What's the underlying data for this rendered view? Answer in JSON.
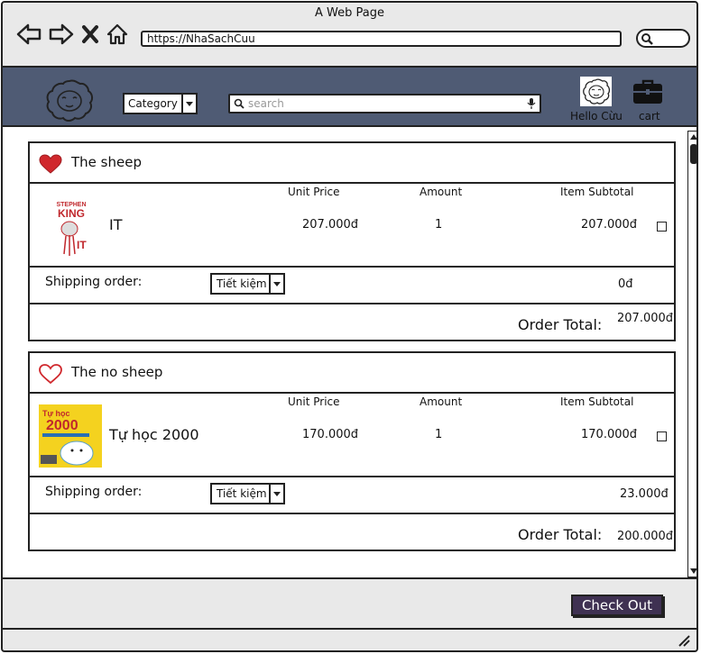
{
  "browser": {
    "window_title": "A Web Page",
    "url": "https://NhaSachCuu"
  },
  "header": {
    "category_label": "Category",
    "search_placeholder": "search",
    "user_greeting": "Hello Cừu",
    "cart_label": "cart"
  },
  "columns": {
    "unit_price": "Unit Price",
    "amount": "Amount",
    "item_subtotal": "Item Subtotal"
  },
  "orders": [
    {
      "shop_name": "The sheep",
      "favorited": true,
      "product": {
        "name": "IT",
        "unit_price": "207.000đ",
        "amount": "1",
        "subtotal": "207.000đ",
        "cover_author": "STEPHEN",
        "cover_author2": "KING",
        "cover_title": "IT"
      },
      "shipping_label": "Shipping order:",
      "shipping_option": "Tiết kiệm",
      "shipping_fee": "0đ",
      "order_total_label": "Order Total:",
      "order_total": "207.000đ"
    },
    {
      "shop_name": "The no sheep",
      "favorited": false,
      "product": {
        "name": "Tự học 2000",
        "unit_price": "170.000đ",
        "amount": "1",
        "subtotal": "170.000đ",
        "cover_title1": "Tự học",
        "cover_title2": "2000"
      },
      "shipping_label": "Shipping order:",
      "shipping_option": "Tiết kiệm",
      "shipping_fee": "23.000đ",
      "order_total_label": "Order Total:",
      "order_total": "200.000đ"
    }
  ],
  "footer": {
    "checkout_label": "Check Out"
  },
  "colors": {
    "header_bg": "#4f5b74",
    "checkout_bg": "#3f3152",
    "heart_red": "#d0282d"
  }
}
